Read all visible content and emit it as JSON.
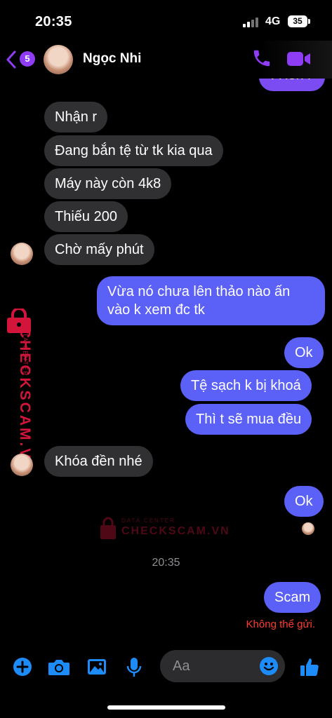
{
  "status": {
    "time": "20:35",
    "network": "4G",
    "battery": "35"
  },
  "header": {
    "back_badge": "5",
    "contact_name": "Ngọc Nhi"
  },
  "partial_message": "À lên r",
  "messages": [
    {
      "dir": "in",
      "text": "Nhận r"
    },
    {
      "dir": "in",
      "text": "Đang bắn tệ từ tk kia qua"
    },
    {
      "dir": "in",
      "text": "Máy này còn 4k8"
    },
    {
      "dir": "in",
      "text": "Thiếu 200"
    },
    {
      "dir": "in",
      "text": "Chờ mấy phút"
    },
    {
      "dir": "out",
      "text": "Vừa nó chưa lên thảo nào ấn vào k xem đc tk"
    },
    {
      "dir": "out",
      "text": "Ok"
    },
    {
      "dir": "out",
      "text": "Tệ sạch k bị khoá"
    },
    {
      "dir": "out",
      "text": "Thì t sẽ mua đều"
    },
    {
      "dir": "in",
      "text": "Khóa đền nhé"
    },
    {
      "dir": "out",
      "text": "Ok"
    },
    {
      "dir": "out",
      "text": "Scam"
    }
  ],
  "timestamp": "20:35",
  "send_error": "Không thể gửi.",
  "watermark": {
    "brand": "CHECKSCAM.VN",
    "sub": "DATA CENTER"
  },
  "composer": {
    "placeholder": "Aa"
  },
  "colors": {
    "accent": "#8f3cf5",
    "outgoing_bubble": "#5b60f6",
    "incoming_bubble": "#303033",
    "error": "#ff3b30",
    "icon_blue": "#1d8cf8",
    "watermark": "#e0173f"
  },
  "icons": [
    "back-chevron-icon",
    "phone-icon",
    "video-camera-icon",
    "plus-icon",
    "camera-icon",
    "image-icon",
    "microphone-icon",
    "emoji-icon",
    "thumbs-up-icon",
    "lock-icon"
  ]
}
